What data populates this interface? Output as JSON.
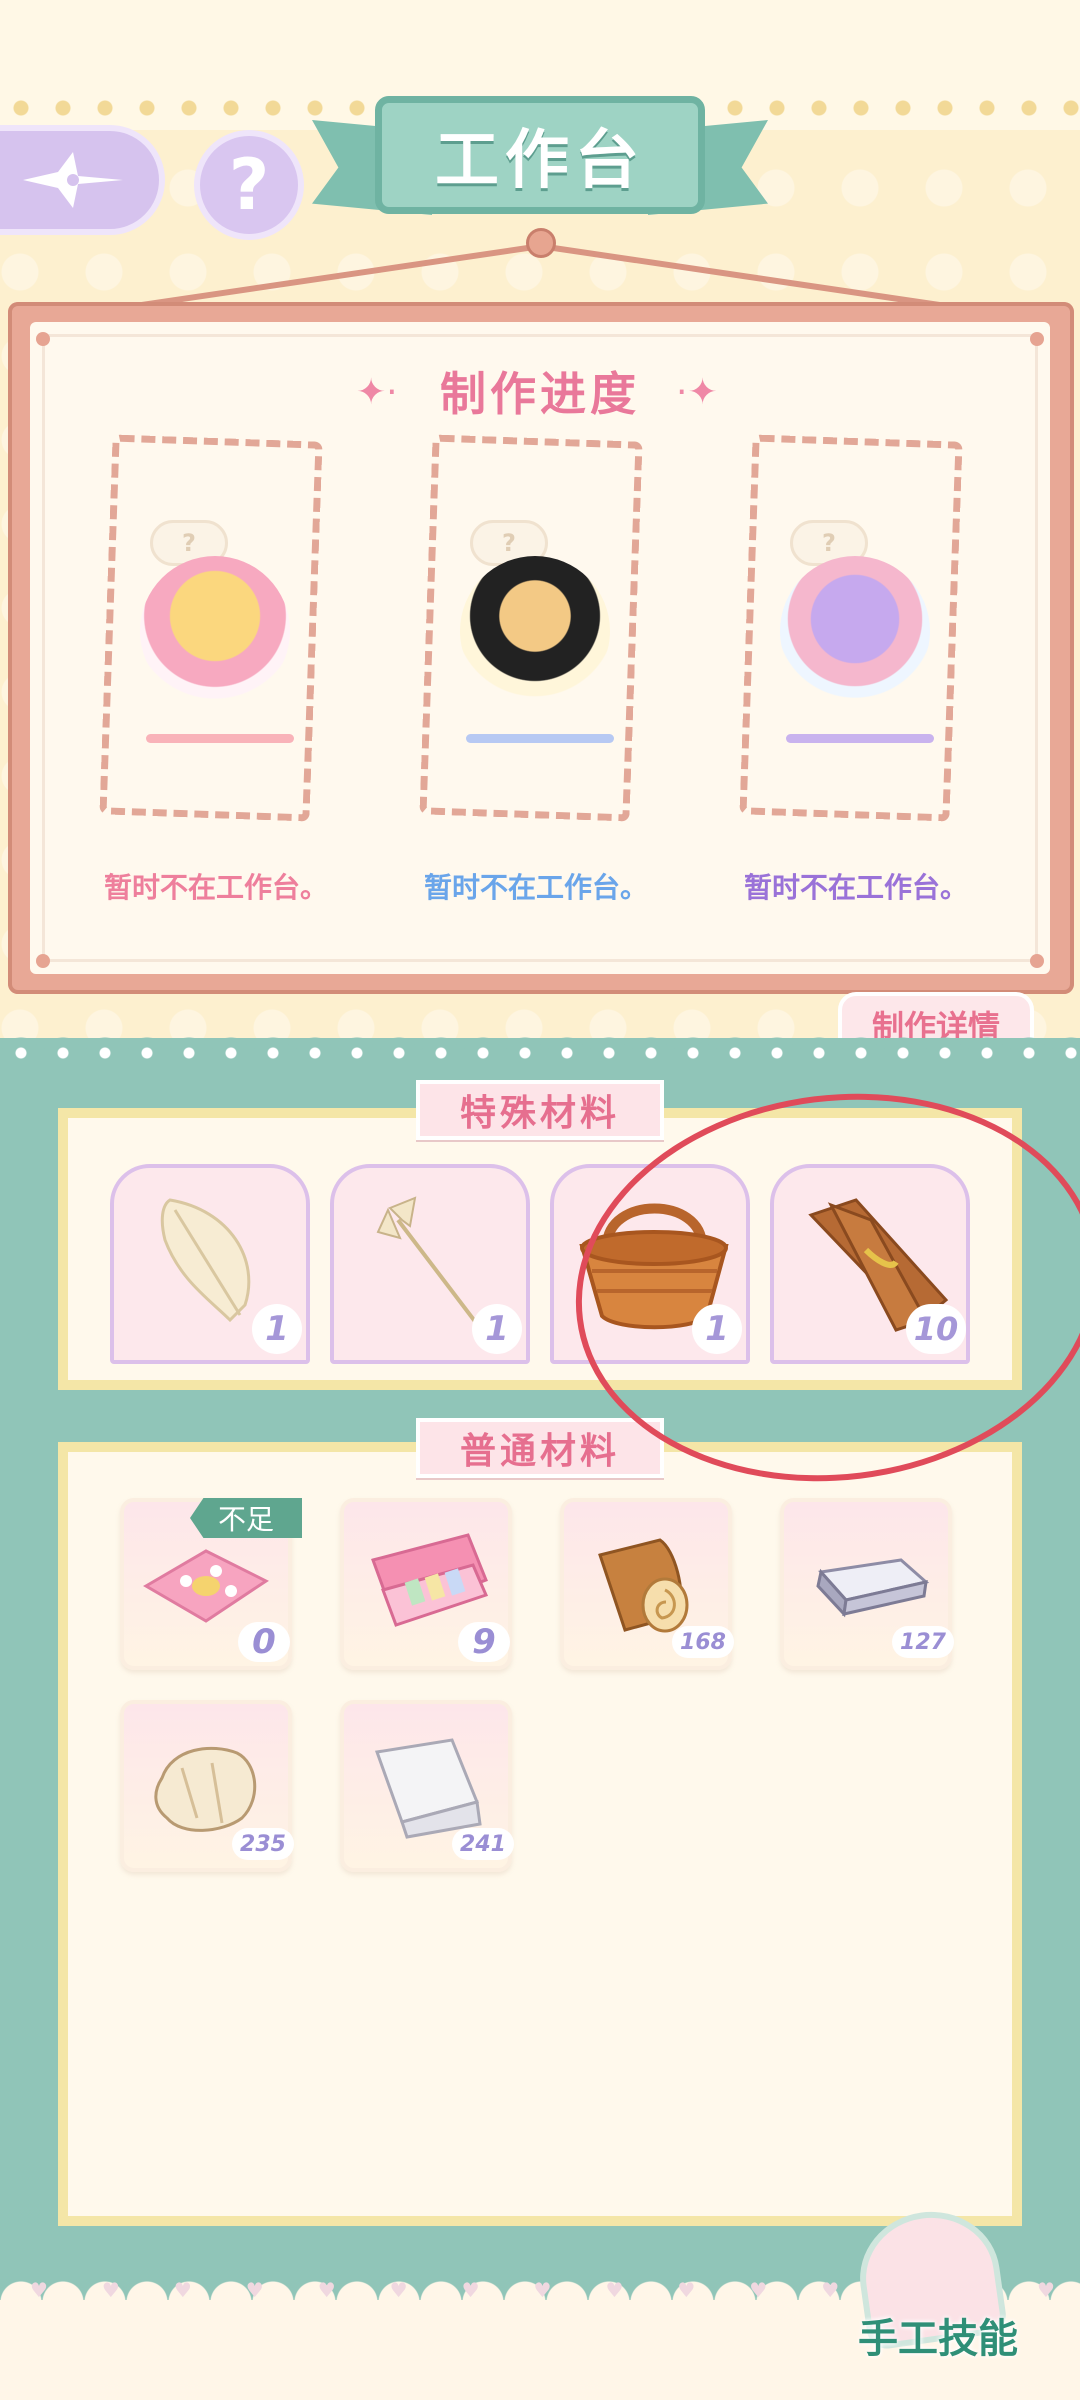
{
  "header": {
    "title": "工作台",
    "back_icon": "compass-back-icon",
    "help_label": "?"
  },
  "progress": {
    "title": "制作进度",
    "slots": [
      {
        "character": "blonde-girl-with-pinwheel",
        "status": "暂时不在工作台。",
        "status_color": "#ee7f9c",
        "bar_color": "#f9b3b9",
        "thought": "?"
      },
      {
        "character": "boy-with-camera",
        "status": "暂时不在工作台。",
        "status_color": "#6aa5ea",
        "bar_color": "#b7c9f3",
        "thought": "?"
      },
      {
        "character": "cat-hood-girl-with-balloons",
        "status": "暂时不在工作台。",
        "status_color": "#9a72d8",
        "bar_color": "#c9b3ee",
        "thought": "?"
      }
    ],
    "detail_tab": "制作详情"
  },
  "special_materials": {
    "label": "特殊材料",
    "items": [
      {
        "icon": "feather-icon",
        "count": "1"
      },
      {
        "icon": "arrow-icon",
        "count": "1"
      },
      {
        "icon": "basket-icon",
        "count": "1"
      },
      {
        "icon": "wood-bundle-icon",
        "count": "10"
      }
    ]
  },
  "normal_materials": {
    "label": "普通材料",
    "short_badge": "不足",
    "items": [
      {
        "icon": "pink-cloth-icon",
        "count": "0"
      },
      {
        "icon": "paint-box-icon",
        "count": "9"
      },
      {
        "icon": "log-icon",
        "count": "168"
      },
      {
        "icon": "silver-ingot-icon",
        "count": "127"
      },
      {
        "icon": "fur-icon",
        "count": "235"
      },
      {
        "icon": "white-fabric-icon",
        "count": "241"
      }
    ]
  },
  "footer": {
    "craft_skill": "手工技能"
  },
  "colors": {
    "teal": "#90c5b8",
    "cream": "#fff9ec",
    "pink_text": "#e66f8f",
    "annotation": "#e04b5a"
  }
}
